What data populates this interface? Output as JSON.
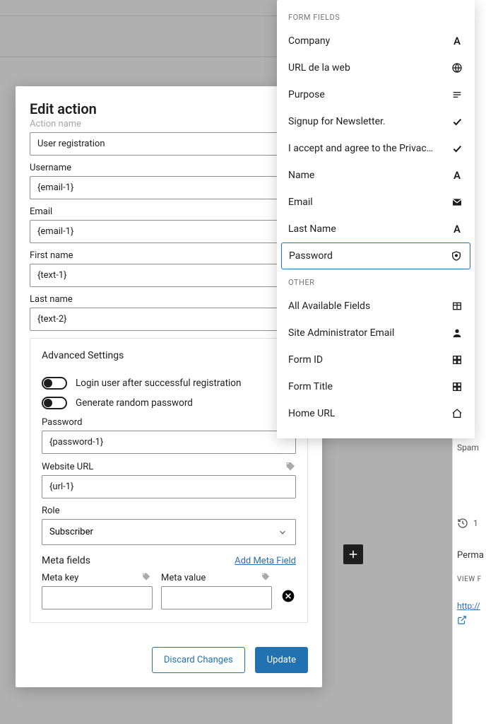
{
  "modal": {
    "title": "Edit action",
    "action_name_label": "Action name",
    "action_name_value": "User registration",
    "username_label": "Username",
    "username_value": "{email-1}",
    "email_label": "Email",
    "email_value": "{email-1}",
    "first_name_label": "First name",
    "first_name_value": "{text-1}",
    "last_name_label": "Last name",
    "last_name_value": "{text-2}",
    "advanced": {
      "heading": "Advanced Settings",
      "toggle_login_label": "Login user after successful registration",
      "toggle_random_pw_label": "Generate random password",
      "password_label": "Password",
      "password_value": "{password-1}",
      "website_url_label": "Website URL",
      "website_url_value": "{url-1}",
      "role_label": "Role",
      "role_value": "Subscriber",
      "meta_fields_label": "Meta fields",
      "add_meta_field_label": "Add Meta Field",
      "meta_key_label": "Meta key",
      "meta_value_label": "Meta value"
    },
    "discard_label": "Discard Changes",
    "update_label": "Update"
  },
  "popover": {
    "section1": "Form Fields",
    "items1": [
      {
        "label": "Company",
        "icon": "letter-a"
      },
      {
        "label": "URL de la web",
        "icon": "globe"
      },
      {
        "label": "Purpose",
        "icon": "lines"
      },
      {
        "label": "Signup for Newsletter.",
        "icon": "check"
      },
      {
        "label": "I accept and agree to the Privacy Pol...",
        "icon": "check"
      },
      {
        "label": "Name",
        "icon": "letter-a"
      },
      {
        "label": "Email",
        "icon": "mail"
      },
      {
        "label": "Last Name",
        "icon": "letter-a"
      },
      {
        "label": "Password",
        "icon": "shield",
        "selected": true
      }
    ],
    "section2": "Other",
    "items2": [
      {
        "label": "All Available Fields",
        "icon": "table"
      },
      {
        "label": "Site Administrator Email",
        "icon": "user"
      },
      {
        "label": "Form ID",
        "icon": "grid"
      },
      {
        "label": "Form Title",
        "icon": "grid"
      },
      {
        "label": "Home URL",
        "icon": "home"
      }
    ]
  },
  "bg": {
    "spam": "Spam",
    "revisions": "1",
    "permalink": "Perma",
    "view": "VIEW F",
    "url": "http://"
  }
}
